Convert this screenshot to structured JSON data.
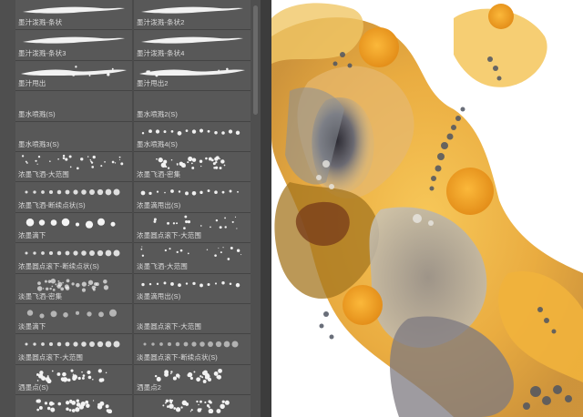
{
  "brushes": [
    {
      "label": "墨汁泼溅-条状",
      "style": "streak"
    },
    {
      "label": "墨汁泼溅-条状2",
      "style": "streak"
    },
    {
      "label": "墨汁泼溅-条状3",
      "style": "streak"
    },
    {
      "label": "墨汁泼溅-条状4",
      "style": "streak"
    },
    {
      "label": "墨汁甩出",
      "style": "splash"
    },
    {
      "label": "墨汁甩出2",
      "style": "splash"
    },
    {
      "label": "墨水喷溅(S)",
      "style": "empty"
    },
    {
      "label": "墨水喷溅2(S)",
      "style": "empty"
    },
    {
      "label": "墨水喷溅3(S)",
      "style": "empty"
    },
    {
      "label": "墨水喷溅4(S)",
      "style": "dots-line"
    },
    {
      "label": "浓墨飞洒-大范围",
      "style": "scatter"
    },
    {
      "label": "浓墨飞洒-密集",
      "style": "cloud"
    },
    {
      "label": "浓墨飞洒-断续点状(S)",
      "style": "dots-fade"
    },
    {
      "label": "浓墨滴甩出(S)",
      "style": "dots-line"
    },
    {
      "label": "浓墨滴下",
      "style": "big-dots"
    },
    {
      "label": "浓墨圆点滚下-大范围",
      "style": "scatter-small"
    },
    {
      "label": "浓墨圆点滚下-断续点状(S)",
      "style": "dots-fade"
    },
    {
      "label": "淡墨飞洒-大范围",
      "style": "scatter-small"
    },
    {
      "label": "淡墨飞洒-密集",
      "style": "cloud-light"
    },
    {
      "label": "淡墨滴甩出(S)",
      "style": "dots-line"
    },
    {
      "label": "淡墨滴下",
      "style": "big-dots-light"
    },
    {
      "label": "淡墨圆点滚下-大范围",
      "style": "empty"
    },
    {
      "label": "淡墨圆点滚下-大范围",
      "style": "dots-fade"
    },
    {
      "label": "淡墨圆点滚下-断续点状(S)",
      "style": "dots-light"
    },
    {
      "label": "洒墨点(S)",
      "style": "cloud"
    },
    {
      "label": "洒墨点2",
      "style": "cloud"
    },
    {
      "label": "",
      "style": "cloud"
    },
    {
      "label": "",
      "style": "cloud"
    }
  ]
}
